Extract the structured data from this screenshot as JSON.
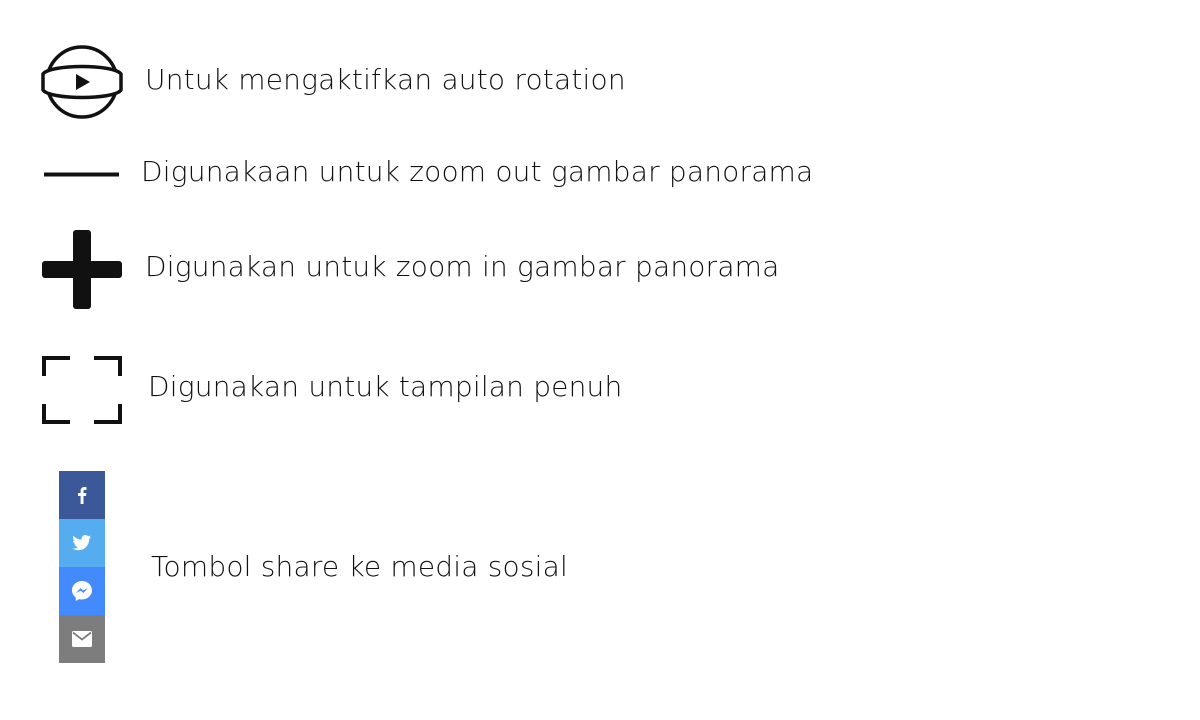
{
  "legend": {
    "items": [
      {
        "icon": "auto-rotate-icon",
        "label": "Untuk mengaktifkan auto rotation"
      },
      {
        "icon": "zoom-out-icon",
        "label": "Digunakaan untuk zoom out gambar panorama"
      },
      {
        "icon": "zoom-in-icon",
        "label": "Digunakan untuk zoom in gambar panorama"
      },
      {
        "icon": "fullscreen-icon",
        "label": "Digunakan untuk tampilan penuh"
      }
    ],
    "share": {
      "label": "Tombol share ke media sosial",
      "buttons": [
        {
          "icon": "facebook-icon",
          "color": "#3b5998"
        },
        {
          "icon": "twitter-icon",
          "color": "#55acee"
        },
        {
          "icon": "messenger-icon",
          "color": "#448aff"
        },
        {
          "icon": "email-icon",
          "color": "#7d7d7d"
        }
      ]
    }
  }
}
